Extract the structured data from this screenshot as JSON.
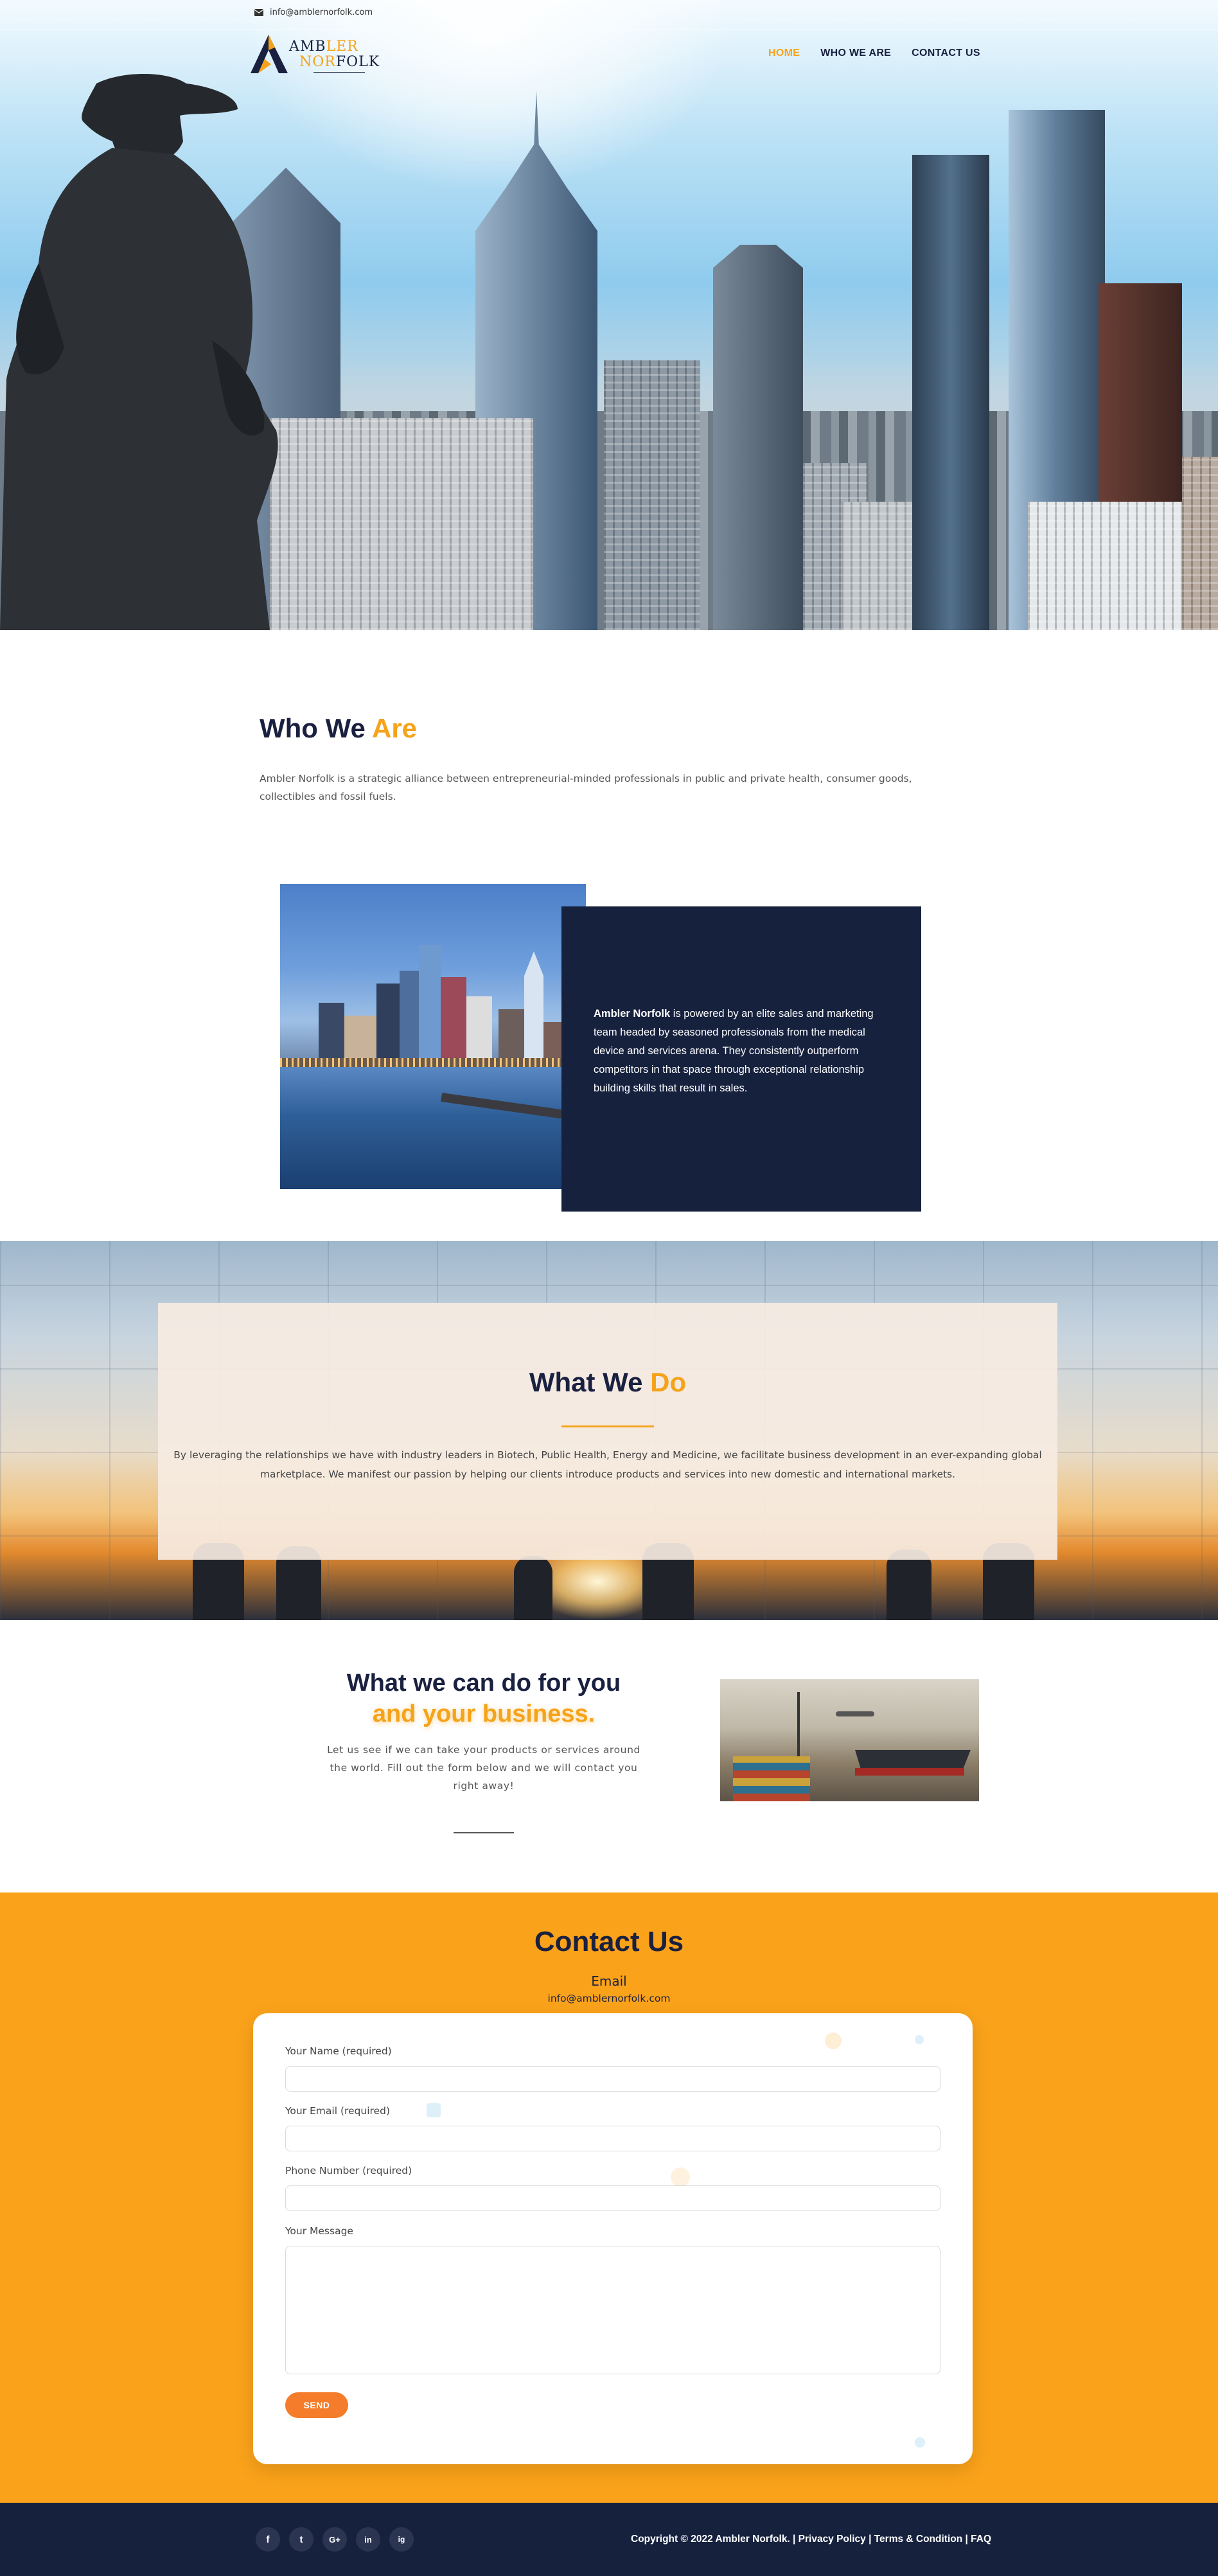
{
  "topbar": {
    "email": "info@amblernorfolk.com"
  },
  "logo": {
    "part1a": "AMB",
    "part1b": "LER",
    "part2a": "NOR",
    "part2b": "FOLK"
  },
  "nav": {
    "items": [
      "HOME",
      "WHO WE ARE",
      "CONTACT US"
    ],
    "active_index": 0
  },
  "who": {
    "title_a": "Who We ",
    "title_b": "Are",
    "text": "Ambler Norfolk is a strategic alliance between entrepreneurial-minded professionals in public and private health, consumer goods, collectibles and fossil fuels.",
    "card_bold": "Ambler Norfolk",
    "card_text": " is powered by an elite sales and marketing team headed by seasoned professionals from the medical device and services arena. They consistently outperform competitors in that space through exceptional relationship building skills that result in sales."
  },
  "wwd": {
    "title_a": "What We ",
    "title_b": "Do",
    "text": "By leveraging the relationships we have with industry leaders in Biotech, Public Health, Energy and Medicine, we facilitate business development in an ever-expanding global marketplace.  We manifest our passion by helping our clients introduce products and services into new domestic and international markets."
  },
  "cando": {
    "line1": "What we can do for you",
    "line2": "and your business.",
    "text": "Let us see if we can take your products or services around the world.  Fill out the form below and we will contact you right away!"
  },
  "contact": {
    "title": "Contact Us",
    "email_label": "Email",
    "email_value": "info@amblernorfolk.com",
    "fields": [
      "Your Name (required)",
      "Your Email (required)",
      "Phone Number (required)",
      "Your Message"
    ],
    "send": "SEND"
  },
  "footer": {
    "social": [
      "f",
      "t",
      "G+",
      "in",
      "ig"
    ],
    "copyright": "Copyright © 2022 Ambler Norfolk. | Privacy Policy | Terms & Condition | FAQ"
  },
  "colors": {
    "navy": "#16213e",
    "orange": "#f5a31a",
    "contact_bg": "#faa21a",
    "send": "#f57c2a"
  }
}
